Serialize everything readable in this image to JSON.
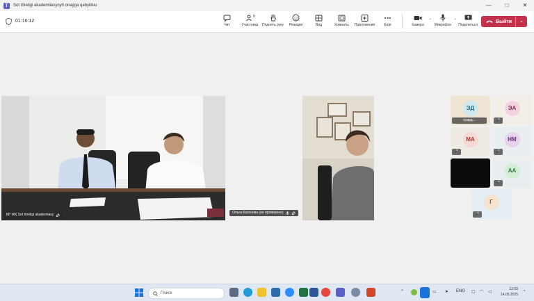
{
  "window": {
    "title": "Sot töreligi akademiiasynyň onaýga qabylduu",
    "controls": [
      "—",
      "□",
      "✕"
    ]
  },
  "meeting": {
    "timer": "01:16:12",
    "tools": [
      {
        "icon": "chat-icon",
        "label": "Чат"
      },
      {
        "icon": "people-icon",
        "label": "Участники",
        "badge": "9"
      },
      {
        "icon": "raise-hand-icon",
        "label": "Поднять руку"
      },
      {
        "icon": "reactions-icon",
        "label": "Реакции"
      },
      {
        "icon": "view-icon",
        "label": "Вид"
      },
      {
        "icon": "rooms-icon",
        "label": "Комнаты"
      },
      {
        "icon": "apps-icon",
        "label": "Приложения"
      },
      {
        "icon": "more-icon",
        "label": "Ещё"
      }
    ],
    "camera_label": "Камера",
    "mic_label": "Микрофон",
    "share_label": "Поделиться",
    "leave_label": "Выйти"
  },
  "tiles": {
    "main_label": "ҚР ЖҚ Sot töreligi akademiasy",
    "second_label": "Ольга Касенова (не проверено)",
    "participants": [
      {
        "initials": "ЭД",
        "tag": "хуард...",
        "bg": "#f0e4d4",
        "av": "#cfe7ee",
        "fg": "#1e6b7e"
      },
      {
        "initials": "ЭА",
        "tag": "",
        "bg": "#f3eee7",
        "av": "#f2d3df",
        "fg": "#8a2a51"
      },
      {
        "initials": "МА",
        "tag": "",
        "bg": "#efebe4",
        "av": "#f7d7d2",
        "fg": "#9e3a2c"
      },
      {
        "initials": "НМ",
        "tag": "",
        "bg": "#e9eef0",
        "av": "#e7d2ee",
        "fg": "#6b2c82"
      },
      {
        "initials": "АА",
        "tag": "",
        "bg": "#e9eef0",
        "av": "#d4eed6",
        "fg": "#2c7a36"
      },
      {
        "initials": "Г",
        "tag": "",
        "bg": "#e6eef5",
        "av": "#f6e3cf",
        "fg": "#8a5a26"
      }
    ]
  },
  "taskbar": {
    "search_placeholder": "Поиск",
    "lang": "ENG",
    "time": "12:03",
    "date": "14.05.2025"
  }
}
